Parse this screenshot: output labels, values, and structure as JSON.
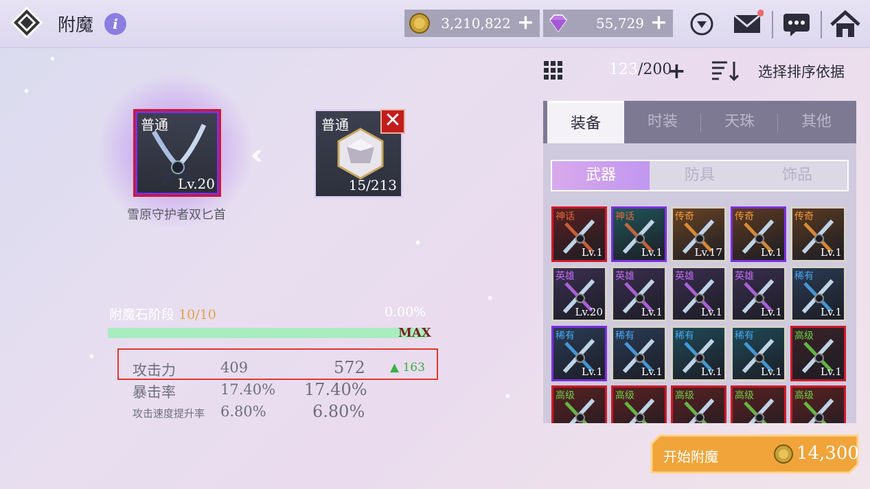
{
  "header": {
    "title": "附魔",
    "info_icon": "i",
    "gold": "3,210,822",
    "gems": "55,729"
  },
  "enchant": {
    "target": {
      "grade": "普通",
      "level": "Lv.20",
      "name": "雪原守护者双匕首"
    },
    "material": {
      "grade": "普通",
      "count": "15/213"
    },
    "stage_label": "附魔石阶段",
    "stage_value": "10/10",
    "stage_percent": "0.00%",
    "progress": 1.0,
    "max_label": "MAX",
    "stats": [
      {
        "name": "攻击力",
        "before": "409",
        "after": "572",
        "delta": "▲ 163"
      },
      {
        "name": "暴击率",
        "before": "17.40%",
        "after": "17.40%"
      },
      {
        "name": "攻击速度提升率",
        "before": "6.80%",
        "after": "6.80%"
      }
    ]
  },
  "inventory": {
    "count_used": "123",
    "count_total": "/200",
    "sort_label": "选择排序依据",
    "tabs": [
      "装备",
      "时装",
      "天珠",
      "其他"
    ],
    "subtabs": [
      "武器",
      "防具",
      "饰品"
    ],
    "items": [
      {
        "grade": "神话",
        "level": "Lv.1",
        "color": "#e06a3a",
        "border": "#d0192a",
        "bg": "#5a2020"
      },
      {
        "grade": "神话",
        "level": "Lv.1",
        "color": "#e06a3a",
        "border": "#7d2ee0",
        "bg": "#1f5559"
      },
      {
        "grade": "传奇",
        "level": "Lv.17",
        "color": "#f09a3a",
        "border": "#d8d3c6",
        "bg": "#6a4324"
      },
      {
        "grade": "传奇",
        "level": "Lv.1",
        "color": "#f09a3a",
        "border": "#7d2ee0",
        "bg": "#5d3a21"
      },
      {
        "grade": "传奇",
        "level": "Lv.1",
        "color": "#f09a3a",
        "border": "#d8d3c6",
        "bg": "#5a3a22"
      },
      {
        "grade": "英雄",
        "level": "Lv.20",
        "color": "#c06bf0",
        "border": "#d8d3c6",
        "bg": "#3b2f52"
      },
      {
        "grade": "英雄",
        "level": "Lv.1",
        "color": "#c06bf0",
        "border": "#d8d3c6",
        "bg": "#3a2e50"
      },
      {
        "grade": "英雄",
        "level": "Lv.1",
        "color": "#c06bf0",
        "border": "#d8d3c6",
        "bg": "#3a2e50"
      },
      {
        "grade": "英雄",
        "level": "Lv.1",
        "color": "#c06bf0",
        "border": "#d8d3c6",
        "bg": "#3a2e50"
      },
      {
        "grade": "稀有",
        "level": "Lv.1",
        "color": "#4aa9f0",
        "border": "#d8d3c6",
        "bg": "#2a3b55"
      },
      {
        "grade": "稀有",
        "level": "Lv.1",
        "color": "#4aa9f0",
        "border": "#7d2ee0",
        "bg": "#2a3b55"
      },
      {
        "grade": "稀有",
        "level": "Lv.1",
        "color": "#4aa9f0",
        "border": "#d8d3c6",
        "bg": "#2a3b55"
      },
      {
        "grade": "稀有",
        "level": "Lv.1",
        "color": "#4aa9f0",
        "border": "#d8d3c6",
        "bg": "#1f4a58"
      },
      {
        "grade": "稀有",
        "level": "Lv.1",
        "color": "#4aa9f0",
        "border": "#d8d3c6",
        "bg": "#1f4a58"
      },
      {
        "grade": "高级",
        "level": "Lv.1",
        "color": "#6cd04a",
        "border": "#d0192a",
        "bg": "#3a2226"
      },
      {
        "grade": "高级",
        "level": "",
        "color": "#6cd04a",
        "border": "#d0192a",
        "bg": "#5a2020"
      },
      {
        "grade": "高级",
        "level": "",
        "color": "#6cd04a",
        "border": "#d0192a",
        "bg": "#5a2020"
      },
      {
        "grade": "高级",
        "level": "",
        "color": "#6cd04a",
        "border": "#d0192a",
        "bg": "#5a2020"
      },
      {
        "grade": "高级",
        "level": "",
        "color": "#6cd04a",
        "border": "#d0192a",
        "bg": "#5a2020"
      },
      {
        "grade": "高级",
        "level": "",
        "color": "#6cd04a",
        "border": "#d0192a",
        "bg": "#5a2020"
      }
    ]
  },
  "start": {
    "label": "开始附魔",
    "cost": "14,300"
  }
}
